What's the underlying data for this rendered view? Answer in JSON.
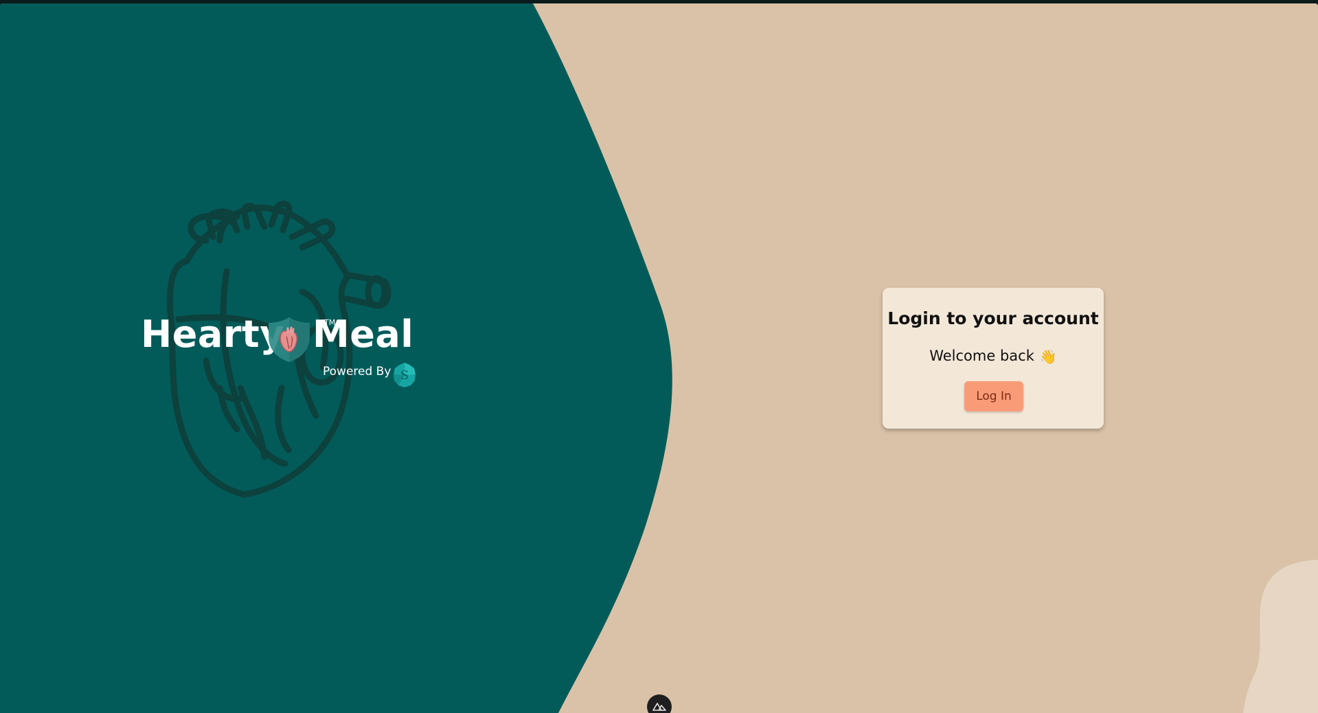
{
  "brand": {
    "word_left": "Hearty",
    "word_right": "Meal",
    "trademark": "TM",
    "powered_by": "Powered By"
  },
  "login_card": {
    "title": "Login to your account",
    "subtitle": "Welcome back",
    "button_label": "Log In"
  },
  "colors": {
    "teal_panel": "#025b59",
    "tan_background": "#d9c2a8",
    "card_background": "#f3e8d8",
    "button": "#fa9b77",
    "heart_outline": "#0f3f3a"
  },
  "icons": {
    "wave": "waving-hand-icon",
    "shield": "heart-shield-icon",
    "partner": "s-logo-icon",
    "devtools": "nuxt-devtools-icon"
  }
}
